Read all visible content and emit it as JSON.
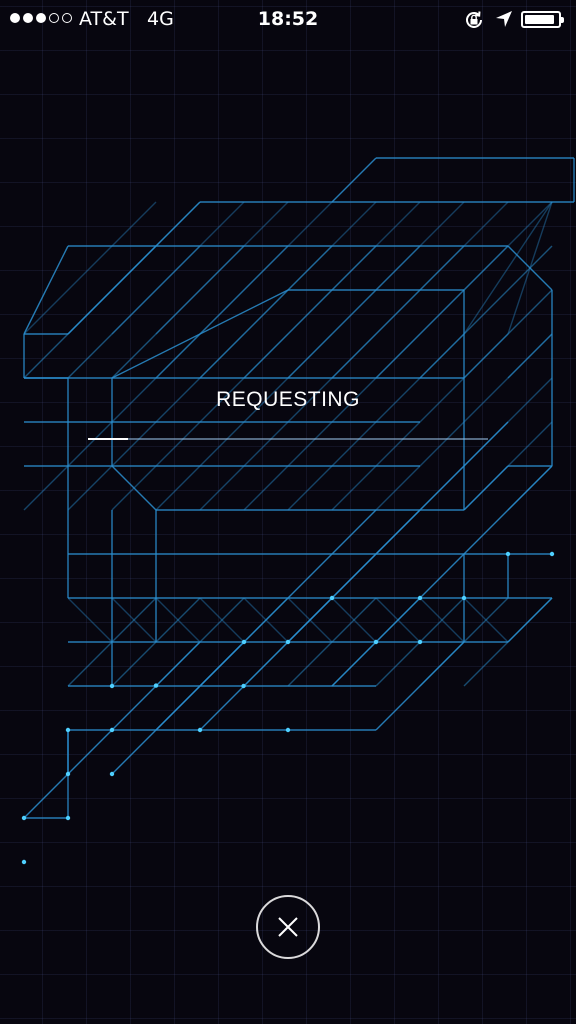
{
  "status_bar": {
    "signal_bars_filled": 3,
    "signal_bars_total": 5,
    "carrier": "AT&T",
    "network": "4G",
    "time": "18:52",
    "battery_level": 0.9
  },
  "main": {
    "status_text": "REQUESTING",
    "progress": 0.1
  },
  "cancel": {
    "icon": "close-icon"
  },
  "colors": {
    "background": "#07060f",
    "line": "#2a8fd0",
    "accent_dot": "#4fd0ff"
  }
}
